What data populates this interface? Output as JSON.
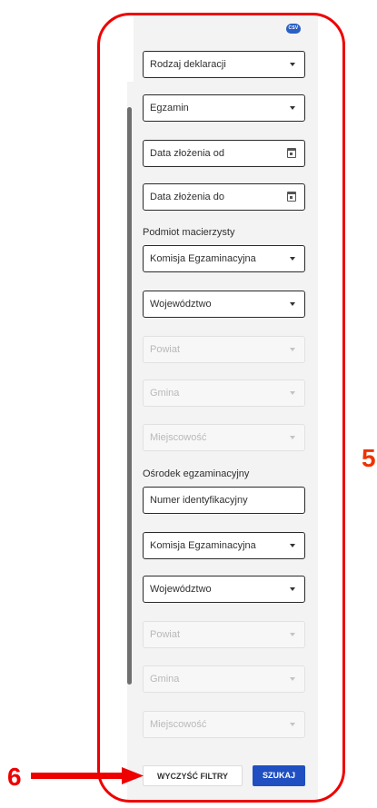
{
  "export": {
    "csv_icon_text": "CSV"
  },
  "filters": {
    "rodzaj_deklaracji": "Rodzaj deklaracji",
    "egzamin": "Egzamin",
    "data_od": "Data złożenia od",
    "data_do": "Data złożenia do"
  },
  "podmiot": {
    "section_label": "Podmiot macierzysty",
    "komisja": "Komisja Egzaminacyjna",
    "wojewodztwo": "Województwo",
    "powiat": "Powiat",
    "gmina": "Gmina",
    "miejscowosc": "Miejscowość"
  },
  "osrodek": {
    "section_label": "Ośrodek egzaminacyjny",
    "numer": "Numer identyfikacyjny",
    "komisja": "Komisja Egzaminacyjna",
    "wojewodztwo": "Województwo",
    "powiat": "Powiat",
    "gmina": "Gmina",
    "miejscowosc": "Miejscowość"
  },
  "actions": {
    "clear_label": "WYCZYŚĆ FILTRY",
    "search_label": "SZUKAJ"
  },
  "annotations": {
    "marker_panel": "5",
    "marker_clear": "6"
  },
  "colors": {
    "frame": "#ee0000",
    "primary": "#1f4fc1",
    "panel_bg": "#f3f3f3"
  }
}
